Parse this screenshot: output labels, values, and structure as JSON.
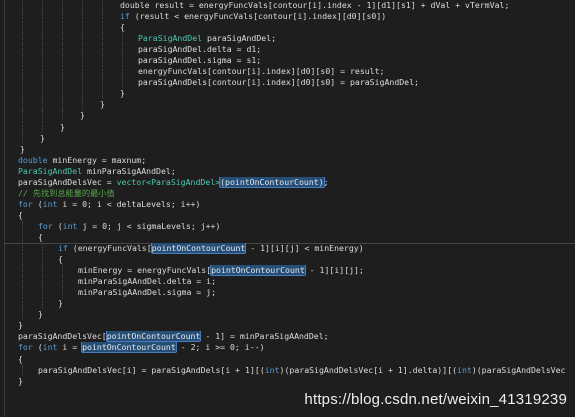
{
  "editor": {
    "lines": [
      {
        "indent": 120,
        "parts": [
          [
            "var",
            "double result = energyFuncVals[contour[i].index - 1][d1][s1] + dVal + vTermVal;"
          ]
        ]
      },
      {
        "indent": 120,
        "parts": [
          [
            "kw",
            "if"
          ],
          [
            "var",
            " (result < energyFuncVals[contour[i].index][d0][s0])"
          ]
        ]
      },
      {
        "indent": 120,
        "parts": [
          [
            "var",
            "{"
          ]
        ]
      },
      {
        "indent": 138,
        "parts": [
          [
            "type",
            "ParaSigAndDel"
          ],
          [
            "var",
            " paraSigAndDel;"
          ]
        ]
      },
      {
        "indent": 138,
        "parts": [
          [
            "var",
            "paraSigAndDel.delta = d1;"
          ]
        ]
      },
      {
        "indent": 138,
        "parts": [
          [
            "var",
            "paraSigAndDel.sigma = s1;"
          ]
        ]
      },
      {
        "indent": 138,
        "parts": [
          [
            "var",
            "energyFuncVals[contour[i].index][d0][s0] = result;"
          ]
        ]
      },
      {
        "indent": 138,
        "parts": [
          [
            "var",
            "paraSigAndDels[contour[i].index][d0][s0] = paraSigAndDel;"
          ]
        ]
      },
      {
        "indent": 120,
        "parts": [
          [
            "var",
            "}"
          ]
        ]
      },
      {
        "indent": 100,
        "parts": [
          [
            "var",
            "}"
          ]
        ]
      },
      {
        "indent": 80,
        "parts": [
          [
            "var",
            "}"
          ]
        ]
      },
      {
        "indent": 60,
        "parts": [
          [
            "var",
            "}"
          ]
        ]
      },
      {
        "indent": 40,
        "parts": [
          [
            "var",
            "}"
          ]
        ]
      },
      {
        "indent": 20,
        "parts": [
          [
            "var",
            "}"
          ]
        ]
      },
      {
        "indent": 18,
        "parts": [
          [
            "kw",
            "double"
          ],
          [
            "var",
            " minEnergy = maxnum;"
          ]
        ]
      },
      {
        "indent": 18,
        "parts": [
          [
            "type",
            "ParaSigAndDel"
          ],
          [
            "var",
            " minParaSigAAndDel;"
          ]
        ]
      },
      {
        "indent": 18,
        "parts": [
          [
            "var",
            "paraSigAndDelsVec = "
          ],
          [
            "type",
            "vector<ParaSigAndDel>"
          ],
          [
            "hl",
            "(pointOnContourCount)"
          ],
          [
            "var",
            ";"
          ]
        ]
      },
      {
        "indent": 18,
        "parts": [
          [
            "cm",
            "// 先找到总能量的最小值"
          ]
        ]
      },
      {
        "indent": 18,
        "parts": [
          [
            "kw",
            "for"
          ],
          [
            "var",
            " ("
          ],
          [
            "kw",
            "int"
          ],
          [
            "var",
            " i = 0; i < deltaLevels; i++)"
          ]
        ]
      },
      {
        "indent": 18,
        "parts": [
          [
            "var",
            "{"
          ]
        ]
      },
      {
        "indent": 38,
        "parts": [
          [
            "kw",
            "for"
          ],
          [
            "var",
            " ("
          ],
          [
            "kw",
            "int"
          ],
          [
            "var",
            " j = 0; j < sigmaLevels; j++)"
          ]
        ]
      },
      {
        "indent": 38,
        "parts": [
          [
            "var",
            "{"
          ]
        ]
      },
      {
        "indent": 58,
        "parts": [
          [
            "kw",
            "if"
          ],
          [
            "var",
            " (energyFuncVals["
          ],
          [
            "hl",
            "pointOnContourCount"
          ],
          [
            "var",
            " - 1][i][j] < minEnergy)"
          ]
        ],
        "current": true
      },
      {
        "indent": 58,
        "parts": [
          [
            "var",
            "{"
          ]
        ]
      },
      {
        "indent": 78,
        "parts": [
          [
            "var",
            "minEnergy = energyFuncVals["
          ],
          [
            "hl",
            "pointOnContourCount"
          ],
          [
            "var",
            " - 1][i][j];"
          ]
        ]
      },
      {
        "indent": 78,
        "parts": [
          [
            "var",
            "minParaSigAAndDel.delta = i;"
          ]
        ]
      },
      {
        "indent": 78,
        "parts": [
          [
            "var",
            "minParaSigAAndDel.sigma = j;"
          ]
        ]
      },
      {
        "indent": 58,
        "parts": [
          [
            "var",
            "}"
          ]
        ]
      },
      {
        "indent": 38,
        "parts": [
          [
            "var",
            "}"
          ]
        ]
      },
      {
        "indent": 18,
        "parts": [
          [
            "var",
            "}"
          ]
        ]
      },
      {
        "indent": 18,
        "parts": [
          [
            "var",
            "paraSigAndDelsVec["
          ],
          [
            "hl",
            "pointOnContourCount"
          ],
          [
            "var",
            " - 1] = minParaSigAAndDel;"
          ]
        ]
      },
      {
        "indent": 18,
        "parts": [
          [
            "kw",
            "for"
          ],
          [
            "var",
            " ("
          ],
          [
            "kw",
            "int"
          ],
          [
            "var",
            " i = "
          ],
          [
            "hl",
            "pointOnContourCount"
          ],
          [
            "var",
            " - 2; i >= 0; i--)"
          ]
        ]
      },
      {
        "indent": 18,
        "parts": [
          [
            "var",
            "{"
          ]
        ]
      },
      {
        "indent": 38,
        "parts": [
          [
            "var",
            "paraSigAndDelsVec[i] = paraSigAndDels[i + 1][("
          ],
          [
            "kw",
            "int"
          ],
          [
            "var",
            ")(paraSigAndDelsVec[i + 1].delta)][("
          ],
          [
            "kw",
            "int"
          ],
          [
            "var",
            ")(paraSigAndDelsVec"
          ]
        ]
      },
      {
        "indent": 18,
        "parts": [
          [
            "var",
            "}"
          ]
        ]
      }
    ],
    "watermark": "https://blog.csdn.net/weixin_41319239"
  },
  "theme": {
    "background": "#1e1e1e",
    "keyword": "#569cd6",
    "type": "#4ec9b0",
    "comment": "#57a64a",
    "text": "#dcdcdc",
    "highlight": "#264f78"
  }
}
